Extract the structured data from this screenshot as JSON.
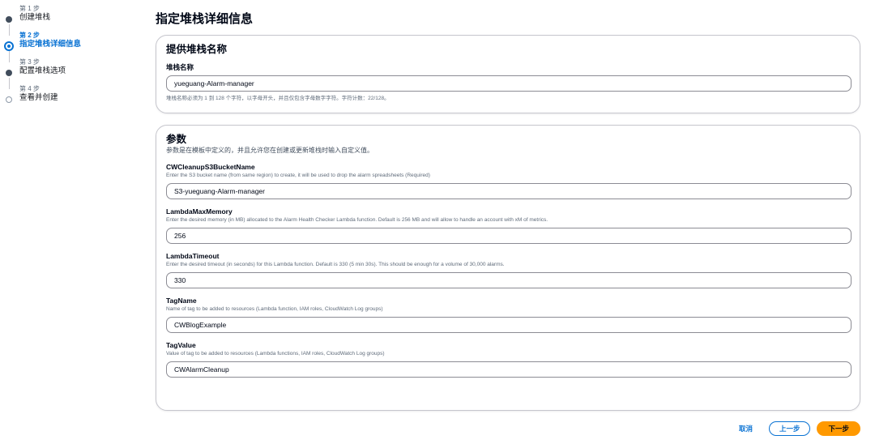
{
  "wizard": {
    "steps": [
      {
        "number": "第 1 步",
        "title": "创建堆栈"
      },
      {
        "number": "第 2 步",
        "title": "指定堆栈详细信息"
      },
      {
        "number": "第 3 步",
        "title": "配置堆栈选项"
      },
      {
        "number": "第 4 步",
        "title": "查看并创建"
      }
    ]
  },
  "page": {
    "title": "指定堆栈详细信息"
  },
  "stack_name_panel": {
    "heading": "提供堆栈名称",
    "label": "堆栈名称",
    "value": "yueguang-Alarm-manager",
    "hint": "堆栈名称必须为 1 到 128 个字符，以字母开头，并且仅包含字母数字字符。字符计数：22/128。"
  },
  "parameters_panel": {
    "heading": "参数",
    "description": "参数是在模板中定义的，并且允许您在创建或更新堆栈时输入自定义值。",
    "params": [
      {
        "name": "CWCleanupS3BucketName",
        "description": "Enter the S3 bucket name (from same region) to create, it will be used to drop the alarm spreadsheets (Required)",
        "value": "S3-yueguang-Alarm-manager"
      },
      {
        "name": "LambdaMaxMemory",
        "description": "Enter the desired memory (in MB) allocated to the Alarm Health Checker Lambda function. Default is 256 MB and will allow to handle an account with xM of metrics.",
        "value": "256"
      },
      {
        "name": "LambdaTimeout",
        "description": "Enter the desired timeout (in seconds) for this Lambda function. Default is 330 (5 min 30s). This should be enough for a volume of 30,000 alarms.",
        "value": "330"
      },
      {
        "name": "TagName",
        "description": "Name of tag to be added to resources (Lambda function, IAM roles, CloudWatch Log groups)",
        "value": "CWBlogExample"
      },
      {
        "name": "TagValue",
        "description": "Value of tag to be added to resources (Lambda functions, IAM roles, CloudWatch Log groups)",
        "value": "CWAlarmCleanup"
      }
    ]
  },
  "footer": {
    "cancel_label": "取消",
    "prev_label": "上一步",
    "next_label": "下一步"
  },
  "colors": {
    "accent": "#0972d3",
    "primary_button": "#ff9900"
  }
}
